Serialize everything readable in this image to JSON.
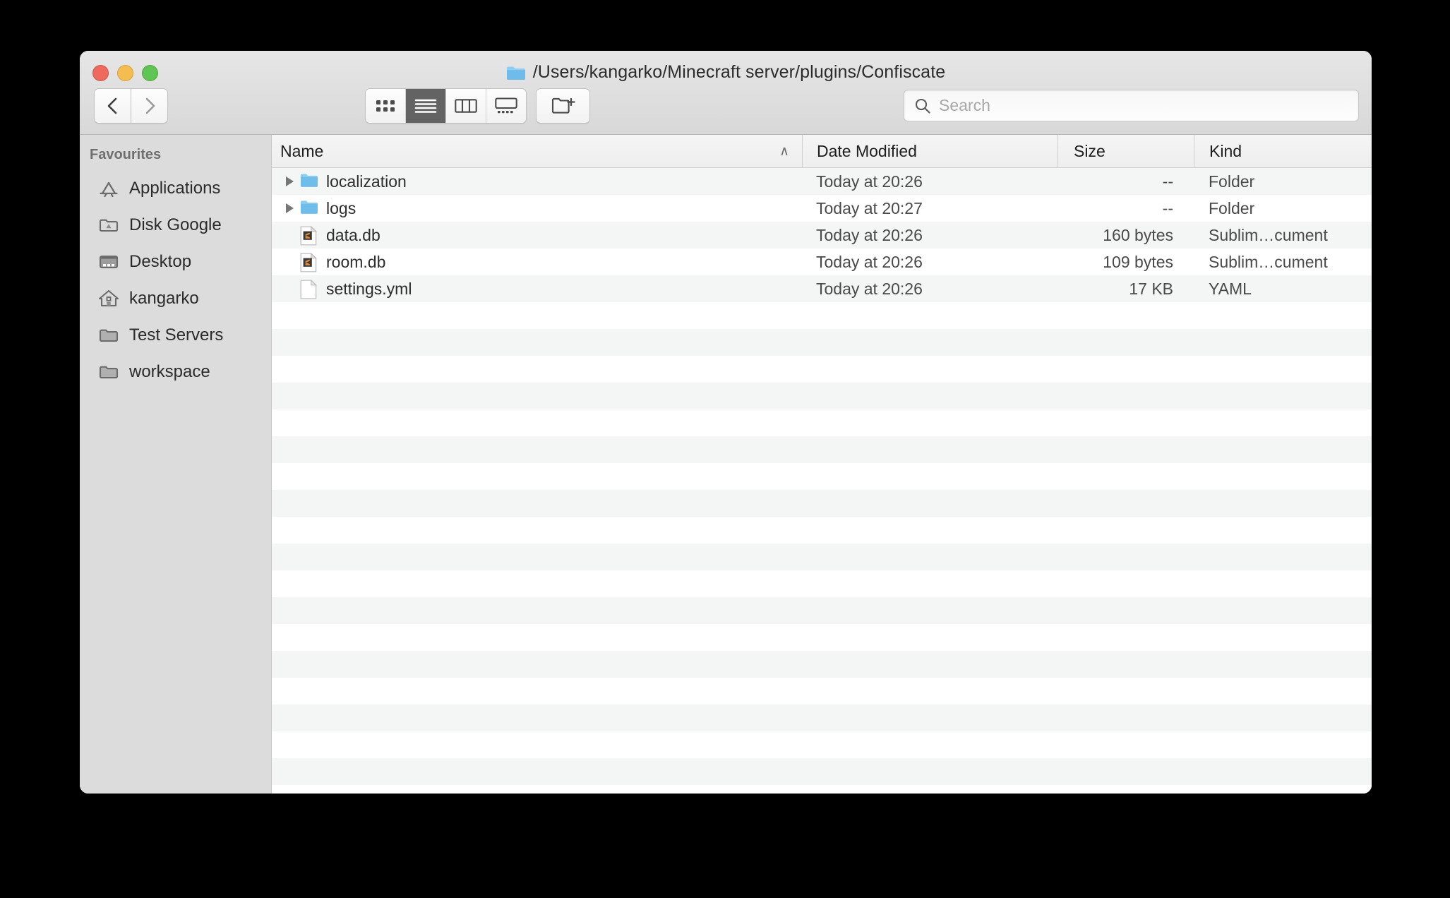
{
  "window": {
    "title": "/Users/kangarko/Minecraft server/plugins/Confiscate",
    "title_icon": "folder-icon",
    "traffic_lights": [
      {
        "name": "close",
        "color": "#ee6a5f"
      },
      {
        "name": "minimize",
        "color": "#f5bd4f"
      },
      {
        "name": "zoom",
        "color": "#61c555"
      }
    ]
  },
  "toolbar": {
    "back_icon": "chevron-left-icon",
    "forward_icon": "chevron-right-icon",
    "view_modes": [
      {
        "name": "icon-view",
        "icon": "grid-icon",
        "active": false
      },
      {
        "name": "list-view",
        "icon": "list-icon",
        "active": true
      },
      {
        "name": "column-view",
        "icon": "columns-icon",
        "active": false
      },
      {
        "name": "gallery-view",
        "icon": "gallery-icon",
        "active": false
      }
    ],
    "new_folder": {
      "name": "new-folder-button",
      "icon": "folder-plus-icon"
    }
  },
  "search": {
    "icon": "search-icon",
    "placeholder": "Search",
    "value": ""
  },
  "sidebar": {
    "header": "Favourites",
    "items": [
      {
        "label": "Applications",
        "icon": "applications-icon"
      },
      {
        "label": "Disk Google",
        "icon": "google-drive-folder-icon"
      },
      {
        "label": "Desktop",
        "icon": "desktop-icon"
      },
      {
        "label": "kangarko",
        "icon": "home-icon"
      },
      {
        "label": "Test Servers",
        "icon": "folder-icon"
      },
      {
        "label": "workspace",
        "icon": "folder-icon"
      }
    ]
  },
  "filelist": {
    "columns": [
      {
        "key": "name",
        "label": "Name",
        "sorted": true,
        "sort_arrow": "∧"
      },
      {
        "key": "date",
        "label": "Date Modified"
      },
      {
        "key": "size",
        "label": "Size"
      },
      {
        "key": "kind",
        "label": "Kind"
      }
    ],
    "rows": [
      {
        "name": "localization",
        "date": "Today at 20:26",
        "size": "--",
        "kind": "Folder",
        "icon": "blue-folder-icon",
        "expandable": true
      },
      {
        "name": "logs",
        "date": "Today at 20:27",
        "size": "--",
        "kind": "Folder",
        "icon": "blue-folder-icon",
        "expandable": true
      },
      {
        "name": "data.db",
        "date": "Today at 20:26",
        "size": "160 bytes",
        "kind": "Sublim…cument",
        "icon": "sublime-document-icon",
        "expandable": false
      },
      {
        "name": "room.db",
        "date": "Today at 20:26",
        "size": "109 bytes",
        "kind": "Sublim…cument",
        "icon": "sublime-document-icon",
        "expandable": false
      },
      {
        "name": "settings.yml",
        "date": "Today at 20:26",
        "size": "17 KB",
        "kind": "YAML",
        "icon": "blank-document-icon",
        "expandable": false
      }
    ],
    "empty_row_count": 19
  },
  "colors": {
    "folder_blue": "#6ec1f0",
    "sublime_orange": "#ef8b2c",
    "titlebar": "#dedede",
    "sidebar": "#dcdcdc",
    "stripe": "#f4f5f5",
    "active_view": "#636363"
  }
}
